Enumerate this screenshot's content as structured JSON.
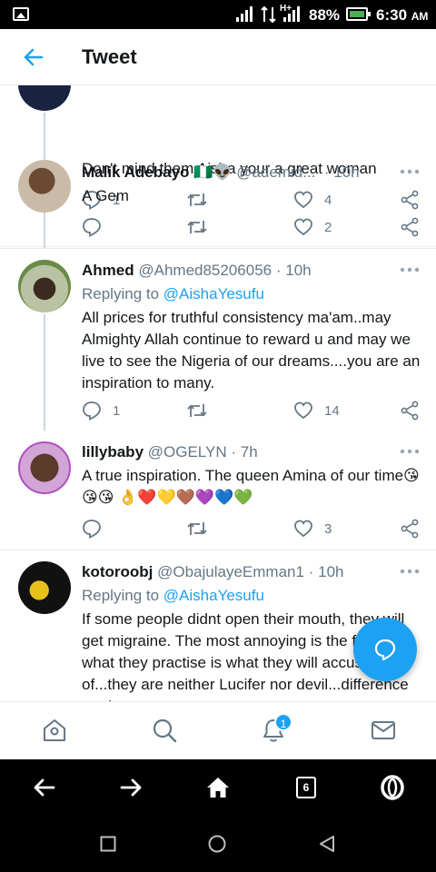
{
  "status_bar": {
    "battery": "88%",
    "time": "6:30",
    "ampm": "AM",
    "network_type": "H+"
  },
  "header": {
    "title": "Tweet"
  },
  "tweets": [
    {
      "text": "Don't mind them Aisha your a great woman",
      "replies": "1",
      "likes": "4"
    },
    {
      "name": "Malik Adebayo",
      "name_emoji": "🇳🇬👽",
      "handle": "@ademid...",
      "time": "10h",
      "text": "A Gem",
      "replies": "",
      "likes": "2"
    },
    {
      "name": "Ahmed",
      "handle": "@Ahmed85206056",
      "time": "10h",
      "replying_to_label": "Replying to",
      "replying_to": "@AishaYesufu",
      "text": "All prices for truthful consistency ma'am..may Almighty Allah continue to reward u and may we live to see the Nigeria of our dreams....you are an inspiration to many.",
      "replies": "1",
      "likes": "14"
    },
    {
      "name": "lillybaby",
      "handle": "@OGELYN",
      "time": "7h",
      "text": "A true inspiration. The queen Amina of our time😘😘😘 👌❤️💛🤎💜💙💚",
      "replies": "",
      "likes": "3"
    },
    {
      "name": "kotoroobj",
      "handle": "@ObajulayeEmman1",
      "time": "10h",
      "replying_to_label": "Replying to",
      "replying_to": "@AishaYesufu",
      "text": "If some people didnt open their mouth, they will get migraine. The most annoying is the fact that what they practise is what they will accused you of...they are neither Lucifer nor devil...difference no dey"
    }
  ],
  "separator": "·",
  "tab_bar": {
    "notifications_badge": "1"
  },
  "browser_bar": {
    "tab_count": "6"
  },
  "colors": {
    "accent": "#1da1f2",
    "secondary_text": "#657786",
    "primary_text": "#14171a",
    "divider": "#e6ecf0"
  }
}
